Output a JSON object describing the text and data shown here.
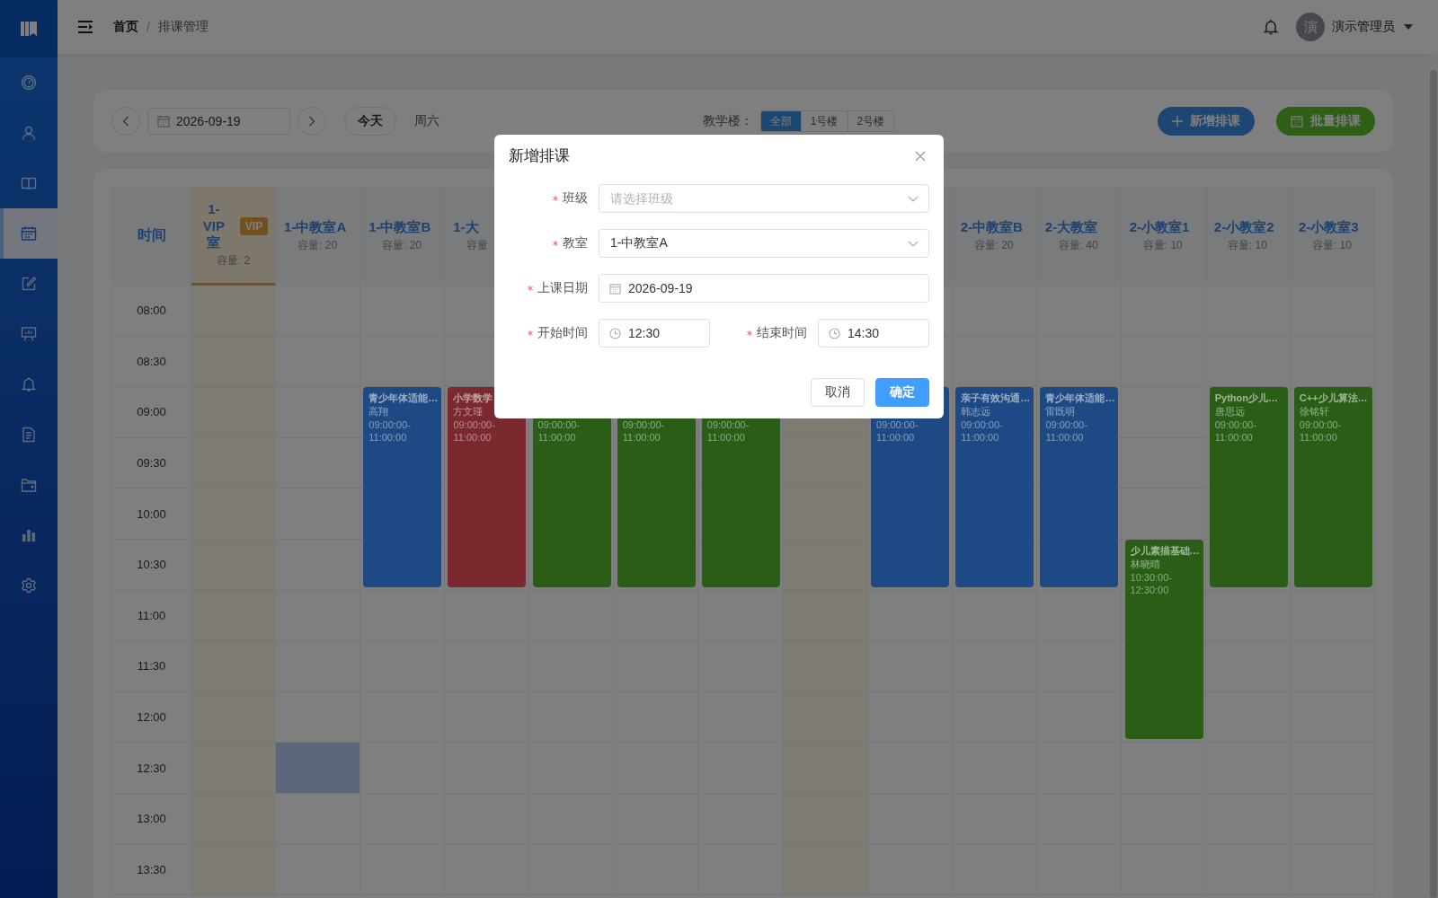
{
  "header": {
    "breadcrumb": [
      "首页",
      "排课管理"
    ],
    "separator": "/",
    "user": {
      "avatar": "演",
      "name": "演示管理员"
    }
  },
  "sidebar": {
    "items": [
      {
        "kind": "gauge",
        "selected": false
      },
      {
        "kind": "user",
        "selected": false
      },
      {
        "kind": "book",
        "selected": false
      },
      {
        "kind": "calendar",
        "selected": true
      },
      {
        "kind": "edit",
        "selected": false
      },
      {
        "kind": "board",
        "selected": false
      },
      {
        "kind": "bell",
        "selected": false
      },
      {
        "kind": "document",
        "selected": false
      },
      {
        "kind": "folder",
        "selected": false
      },
      {
        "kind": "chart",
        "selected": false
      },
      {
        "kind": "settings",
        "selected": false
      }
    ]
  },
  "toolbar": {
    "date": "2026-09-19",
    "today_button": "今天",
    "weekday": "周六",
    "building_label": "教学楼：",
    "buildings": [
      {
        "label": "全部",
        "selected": true
      },
      {
        "label": "1号楼",
        "selected": false
      },
      {
        "label": "2号楼",
        "selected": false
      }
    ],
    "buttons": [
      {
        "label": "新增排课",
        "kind": "add"
      },
      {
        "label": "批量排课",
        "kind": "batch"
      }
    ]
  },
  "schedule": {
    "time_heading": "时间",
    "rows": [
      {
        "time": "08:00",
        "selected": false
      },
      {
        "time": "08:30",
        "selected": false
      },
      {
        "time": "09:00",
        "selected": false
      },
      {
        "time": "09:30",
        "selected": false
      },
      {
        "time": "10:00",
        "selected": false
      },
      {
        "time": "10:30",
        "selected": false
      },
      {
        "time": "11:00",
        "selected": false
      },
      {
        "time": "11:30",
        "selected": false
      },
      {
        "time": "12:00",
        "selected": false
      },
      {
        "time": "12:30",
        "selected": true
      },
      {
        "time": "13:00",
        "selected": false
      },
      {
        "time": "13:30",
        "selected": false
      }
    ],
    "columns": [
      {
        "kind": "vip",
        "name": "1-VIP室",
        "badge": "VIP",
        "capacity": "容量: 2",
        "selected": false
      },
      {
        "kind": "standard",
        "name": "1-中教室A",
        "capacity": "容量: 20",
        "selected": true
      },
      {
        "kind": "standard",
        "name": "1-中教室B",
        "capacity": "容量: 20",
        "selected": false,
        "events": [
          {
            "title": "青少年体适能…",
            "teacher": "高翔",
            "time": "09:00:00-11:00:00",
            "color": "#1d4a84"
          }
        ]
      },
      {
        "kind": "standard",
        "name": "1-大",
        "capacity": "容量",
        "selected": false,
        "events": [
          {
            "title": "小学数学",
            "teacher": "方文瑾",
            "time": "09:00:00-11:00:00",
            "color": "#7a2a2f"
          }
        ]
      },
      {
        "kind": "standard",
        "selected": false,
        "events": [
          {
            "time": "09:00:00-11:00:00",
            "color": "#2a5e17"
          }
        ]
      },
      {
        "kind": "standard",
        "selected": false,
        "events": [
          {
            "time": "09:00:00-11:00:00",
            "color": "#2a5e17"
          }
        ]
      },
      {
        "kind": "standard",
        "selected": false,
        "events": [
          {
            "time": "09:00:00-11:00:00",
            "color": "#2a5e17"
          }
        ]
      },
      {
        "kind": "vip",
        "selected": false
      },
      {
        "kind": "standard",
        "selected": false,
        "events": [
          {
            "time": "09:00:00-11:00:00",
            "color": "#1d4a84"
          }
        ]
      },
      {
        "kind": "standard",
        "name": "2-中教室B",
        "capacity": "容量: 20",
        "selected": false,
        "events": [
          {
            "title": "亲子有效沟通…",
            "teacher": "韩志远",
            "time": "09:00:00-11:00:00",
            "color": "#1d4a84"
          }
        ]
      },
      {
        "kind": "standard",
        "name": "2-大教室",
        "capacity": "容量: 40",
        "selected": false,
        "events": [
          {
            "title": "青少年体适能…",
            "teacher": "雷既明",
            "time": "09:00:00-11:00:00",
            "color": "#1d4a84"
          }
        ]
      },
      {
        "kind": "standard",
        "name": "2-小教室1",
        "capacity": "容量: 10",
        "selected": false,
        "events": [
          {
            "title": "少儿素描基础…",
            "teacher": "林晓晴",
            "time": "10:30:00-12:30:00",
            "color": "#2a5e17"
          }
        ]
      },
      {
        "kind": "standard",
        "name": "2-小教室2",
        "capacity": "容量: 10",
        "selected": false,
        "events": [
          {
            "title": "Python少儿…",
            "teacher": "唐思远",
            "time": "09:00:00-11:00:00",
            "color": "#2a5e17"
          }
        ]
      },
      {
        "kind": "standard",
        "name": "2-小教室3",
        "capacity": "容量: 10",
        "selected": false,
        "events": [
          {
            "title": "C++少儿算法…",
            "teacher": "徐铭轩",
            "time": "09:00:00-11:00:00",
            "color": "#2a5e17"
          }
        ]
      }
    ]
  },
  "dialog": {
    "title": "新增排课",
    "fields": [
      {
        "label": "班级",
        "required": true,
        "kind": "select",
        "placeholder": "请选择班级"
      },
      {
        "label": "教室",
        "required": true,
        "kind": "select",
        "value": "1-中教室A"
      },
      {
        "label": "上课日期",
        "required": true,
        "kind": "date",
        "value": "2026-09-19"
      }
    ],
    "time_fields": [
      {
        "label": "开始时间",
        "required": true,
        "value": "12:30"
      },
      {
        "label": "结束时间",
        "required": true,
        "value": "14:30"
      }
    ],
    "buttons": [
      {
        "label": "取消",
        "kind": "secondary"
      },
      {
        "label": "确定",
        "kind": "primary"
      }
    ]
  }
}
